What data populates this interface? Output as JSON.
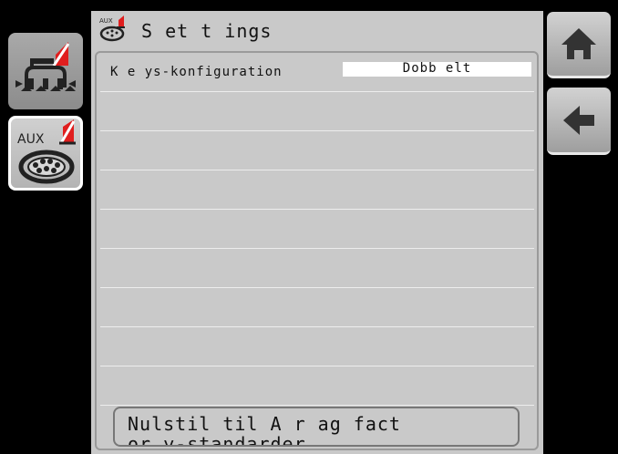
{
  "header": {
    "title": "S et t ings",
    "title_icon": "aux-joystick-icon"
  },
  "left_softkeys": [
    {
      "name": "sprayer-boom-icon"
    },
    {
      "name": "aux-joystick-icon",
      "label": "AUX"
    }
  ],
  "settings": {
    "rows": [
      {
        "label": "K e ys-konfiguration",
        "value": "Dobb elt"
      },
      {
        "label": "",
        "value": ""
      },
      {
        "label": "",
        "value": ""
      },
      {
        "label": "",
        "value": ""
      },
      {
        "label": "",
        "value": ""
      },
      {
        "label": "",
        "value": ""
      },
      {
        "label": "",
        "value": ""
      },
      {
        "label": "",
        "value": ""
      },
      {
        "label": "",
        "value": ""
      }
    ]
  },
  "reset_button": {
    "label": "Nulstil til A r ag fact or y-standarder"
  },
  "right_softkeys": [
    {
      "name": "home-icon"
    },
    {
      "name": "back-arrow-icon"
    }
  ],
  "colors": {
    "panel": "#c9c9c9",
    "background": "#000000",
    "accent_red": "#e01e1e"
  }
}
